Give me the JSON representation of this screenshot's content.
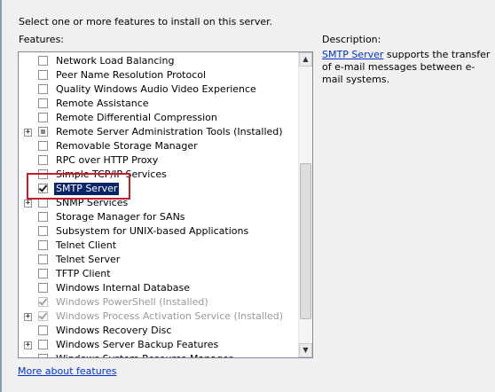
{
  "instruction": "Select one or more features to install on this server.",
  "features_label": "Features:",
  "description": {
    "label": "Description:",
    "link_text": "SMTP Server",
    "text": " supports the transfer of e-mail messages between e-mail systems."
  },
  "features": [
    {
      "label": "Network Load Balancing",
      "checked": false,
      "disabled": false,
      "expander": false
    },
    {
      "label": "Peer Name Resolution Protocol",
      "checked": false,
      "disabled": false,
      "expander": false
    },
    {
      "label": "Quality Windows Audio Video Experience",
      "checked": false,
      "disabled": false,
      "expander": false
    },
    {
      "label": "Remote Assistance",
      "checked": false,
      "disabled": false,
      "expander": false
    },
    {
      "label": "Remote Differential Compression",
      "checked": false,
      "disabled": false,
      "expander": false
    },
    {
      "label": "Remote Server Administration Tools  (Installed)",
      "checked": false,
      "partial": true,
      "disabled": false,
      "expander": true
    },
    {
      "label": "Removable Storage Manager",
      "checked": false,
      "disabled": false,
      "expander": false
    },
    {
      "label": "RPC over HTTP Proxy",
      "checked": false,
      "disabled": false,
      "expander": false
    },
    {
      "label": "Simple TCP/IP Services",
      "checked": false,
      "disabled": false,
      "expander": false
    },
    {
      "label": "SMTP Server",
      "checked": true,
      "disabled": false,
      "expander": false,
      "selected": true
    },
    {
      "label": "SNMP Services",
      "checked": false,
      "disabled": false,
      "expander": true
    },
    {
      "label": "Storage Manager for SANs",
      "checked": false,
      "disabled": false,
      "expander": false
    },
    {
      "label": "Subsystem for UNIX-based Applications",
      "checked": false,
      "disabled": false,
      "expander": false
    },
    {
      "label": "Telnet Client",
      "checked": false,
      "disabled": false,
      "expander": false
    },
    {
      "label": "Telnet Server",
      "checked": false,
      "disabled": false,
      "expander": false
    },
    {
      "label": "TFTP Client",
      "checked": false,
      "disabled": false,
      "expander": false
    },
    {
      "label": "Windows Internal Database",
      "checked": false,
      "disabled": false,
      "expander": false
    },
    {
      "label": "Windows PowerShell  (Installed)",
      "checked": true,
      "disabled": true,
      "expander": false
    },
    {
      "label": "Windows Process Activation Service  (Installed)",
      "checked": true,
      "disabled": true,
      "expander": true
    },
    {
      "label": "Windows Recovery Disc",
      "checked": false,
      "disabled": false,
      "expander": false
    },
    {
      "label": "Windows Server Backup Features",
      "checked": false,
      "disabled": false,
      "expander": true
    },
    {
      "label": "Windows System Resource Manager",
      "checked": false,
      "disabled": false,
      "expander": false
    }
  ],
  "expander_glyph": "+",
  "scroll_up_glyph": "▲",
  "scroll_down_glyph": "▼",
  "more_link": "More about features",
  "colors": {
    "selection": "#0a246a",
    "highlight_box": "#c0202a",
    "link": "#0033cc"
  }
}
